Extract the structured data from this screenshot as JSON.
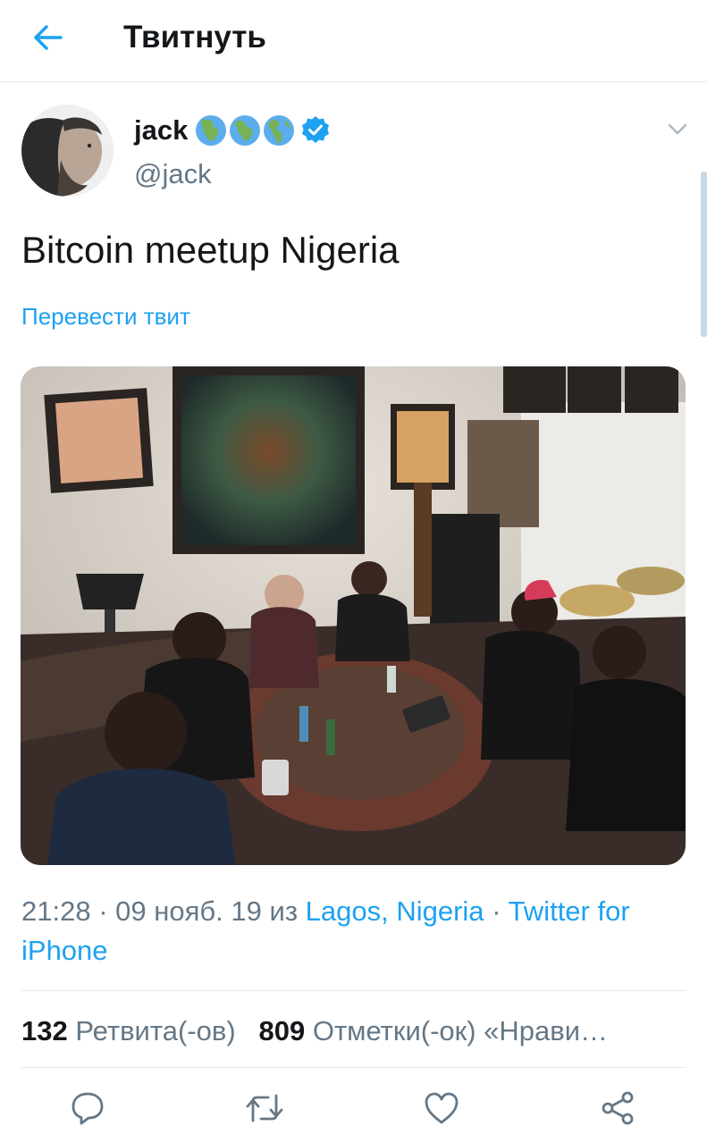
{
  "header": {
    "title": "Твитнуть"
  },
  "tweet": {
    "author_name": "jack",
    "author_handle": "@jack",
    "text": "Bitcoin meetup Nigeria",
    "translate_label": "Перевести твит",
    "time": "21:28",
    "date": "09 нояб. 19",
    "from_label": "из",
    "location": "Lagos, Nigeria",
    "separator": "·",
    "client": "Twitter for iPhone"
  },
  "stats": {
    "retweets_count": "132",
    "retweets_label": "Ретвита(-ов)",
    "likes_count": "809",
    "likes_label": "Отметки(-ок) «Нрави…"
  },
  "icons": {
    "back": "arrow-left-icon",
    "badges": [
      "globe-africa-icon",
      "globe-africa-icon",
      "globe-americas-icon",
      "verified-icon"
    ],
    "caret": "chevron-down-icon",
    "actions": [
      "reply-icon",
      "retweet-icon",
      "like-icon",
      "share-icon"
    ]
  },
  "colors": {
    "accent": "#1da1f2",
    "text": "#14171a",
    "secondary": "#657786",
    "divider": "#e1e8ed"
  }
}
